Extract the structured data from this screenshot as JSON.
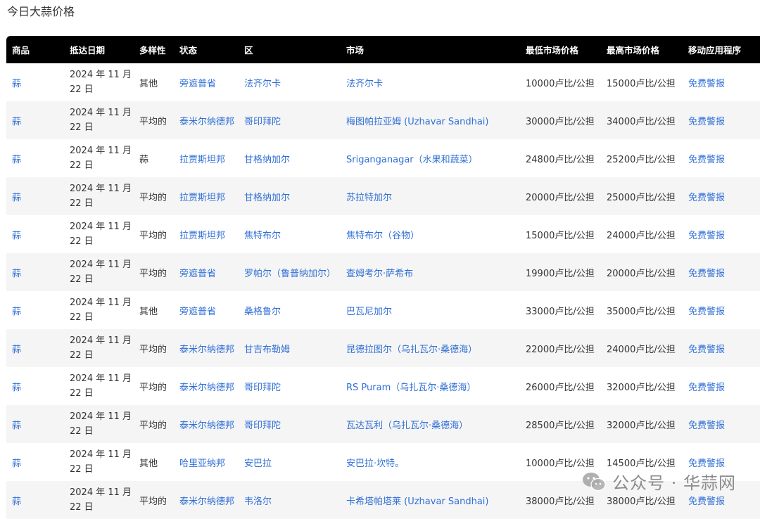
{
  "page": {
    "title": "今日大蒜价格"
  },
  "table": {
    "headers": [
      "商品",
      "抵达日期",
      "多样性",
      "状态",
      "区",
      "市场",
      "最低市场价格",
      "最高市场价格",
      "移动应用程序"
    ],
    "rows": [
      {
        "commodity": "蒜",
        "date_line1": "2024 年 11 月",
        "date_line2": "22 日",
        "variety": "其他",
        "state": "旁遮普省",
        "district": "法齐尔卡",
        "market": "法齐尔卡",
        "min": "10000卢比/公担",
        "max": "15000卢比/公担",
        "app": "免费警报"
      },
      {
        "commodity": "蒜",
        "date_line1": "2024 年 11 月",
        "date_line2": "22 日",
        "variety": "平均的",
        "state": "泰米尔纳德邦",
        "district": "哥印拜陀",
        "market": "梅图帕拉亚姆 (Uzhavar Sandhai)",
        "min": "30000卢比/公担",
        "max": "34000卢比/公担",
        "app": "免费警报"
      },
      {
        "commodity": "蒜",
        "date_line1": "2024 年 11 月",
        "date_line2": "22 日",
        "variety": "蒜",
        "state": "拉贾斯坦邦",
        "district": "甘格纳加尔",
        "market": "Sriganganagar（水果和蔬菜）",
        "min": "24800卢比/公担",
        "max": "25200卢比/公担",
        "app": "免费警报"
      },
      {
        "commodity": "蒜",
        "date_line1": "2024 年 11 月",
        "date_line2": "22 日",
        "variety": "平均的",
        "state": "拉贾斯坦邦",
        "district": "甘格纳加尔",
        "market": "苏拉特加尔",
        "min": "20000卢比/公担",
        "max": "25000卢比/公担",
        "app": "免费警报"
      },
      {
        "commodity": "蒜",
        "date_line1": "2024 年 11 月",
        "date_line2": "22 日",
        "variety": "平均的",
        "state": "拉贾斯坦邦",
        "district": "焦特布尔",
        "market": "焦特布尔（谷物）",
        "min": "15000卢比/公担",
        "max": "24000卢比/公担",
        "app": "免费警报"
      },
      {
        "commodity": "蒜",
        "date_line1": "2024 年 11 月",
        "date_line2": "22 日",
        "variety": "平均的",
        "state": "旁遮普省",
        "district": "罗帕尔（鲁普纳加尔）",
        "market": "查姆考尔·萨希布",
        "min": "19900卢比/公担",
        "max": "20000卢比/公担",
        "app": "免费警报"
      },
      {
        "commodity": "蒜",
        "date_line1": "2024 年 11 月",
        "date_line2": "22 日",
        "variety": "其他",
        "state": "旁遮普省",
        "district": "桑格鲁尔",
        "market": "巴瓦尼加尔",
        "min": "33000卢比/公担",
        "max": "35000卢比/公担",
        "app": "免费警报"
      },
      {
        "commodity": "蒜",
        "date_line1": "2024 年 11 月",
        "date_line2": "22 日",
        "variety": "平均的",
        "state": "泰米尔纳德邦",
        "district": "甘吉布勒姆",
        "market": "昆德拉图尔（乌扎瓦尔·桑德海）",
        "min": "22000卢比/公担",
        "max": "24000卢比/公担",
        "app": "免费警报"
      },
      {
        "commodity": "蒜",
        "date_line1": "2024 年 11 月",
        "date_line2": "22 日",
        "variety": "平均的",
        "state": "泰米尔纳德邦",
        "district": "哥印拜陀",
        "market": "RS Puram（乌扎瓦尔·桑德海）",
        "min": "26000卢比/公担",
        "max": "32000卢比/公担",
        "app": "免费警报"
      },
      {
        "commodity": "蒜",
        "date_line1": "2024 年 11 月",
        "date_line2": "22 日",
        "variety": "平均的",
        "state": "泰米尔纳德邦",
        "district": "哥印拜陀",
        "market": "瓦达瓦利（乌扎瓦尔·桑德海）",
        "min": "28500卢比/公担",
        "max": "32000卢比/公担",
        "app": "免费警报"
      },
      {
        "commodity": "蒜",
        "date_line1": "2024 年 11 月",
        "date_line2": "22 日",
        "variety": "其他",
        "state": "哈里亚纳邦",
        "district": "安巴拉",
        "market": "安巴拉·坎特。",
        "min": "10000卢比/公担",
        "max": "14500卢比/公担",
        "app": "免费警报"
      },
      {
        "commodity": "蒜",
        "date_line1": "2024 年 11 月",
        "date_line2": "22 日",
        "variety": "平均的",
        "state": "泰米尔纳德邦",
        "district": "韦洛尔",
        "market": "卡希塔帕塔莱 (Uzhavar Sandhai)",
        "min": "38000卢比/公担",
        "max": "38000卢比/公担",
        "app": "免费警报"
      }
    ]
  },
  "watermark": {
    "text": "公众号 · 华蒜网",
    "icon": "wechat-icon"
  },
  "colors": {
    "header_bg": "#000000",
    "link": "#2f6fd6",
    "stripe": "#f5f5f5"
  }
}
